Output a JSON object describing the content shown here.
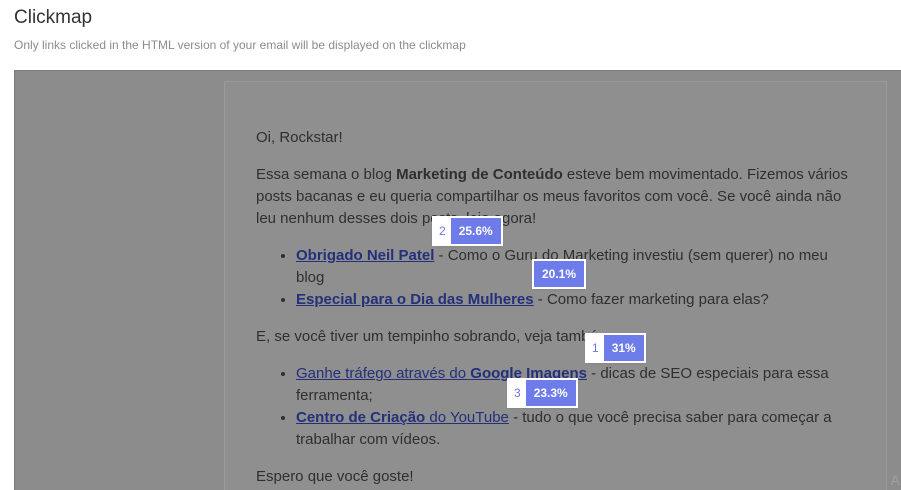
{
  "header": {
    "title": "Clickmap",
    "subtitle": "Only links clicked in the HTML version of your email will be displayed on the clickmap"
  },
  "email": {
    "greeting": "Oi, Rockstar!",
    "para1_start": "Essa semana o blog ",
    "para1_bold": "Marketing de Conteúdo",
    "para1_end": " esteve bem movimentado. Fizemos vários posts bacanas e eu queria compartilhar os meus favoritos com você. Se você ainda não leu nenhum desses dois posts, leia agora!",
    "list1": [
      {
        "link": "Obrigado Neil Patel",
        "text": " - Como o Guru do Marketing investiu (sem querer) no meu blog"
      },
      {
        "link": "Especial para o Dia das Mulheres",
        "text": " - Como fazer marketing para elas?"
      }
    ],
    "para2": "E, se você tiver um tempinho sobrando, veja também:",
    "list2": [
      {
        "link_plain": "Ganhe tráfego através do ",
        "link_bold": "Google Imagens",
        "text": " - dicas de SEO especiais para essa ferramenta;"
      },
      {
        "link_bold": "Centro de Criação",
        "link_plain": " do YouTube",
        "text": " - tudo o que você precisa saber para começar a trabalhar com vídeos."
      }
    ],
    "closing": "Espero que você goste!"
  },
  "clicks": [
    {
      "rank": "2",
      "percent": "25.6%"
    },
    {
      "rank": "",
      "percent": "20.1%"
    },
    {
      "rank": "1",
      "percent": "31%"
    },
    {
      "rank": "3",
      "percent": "23.3%"
    }
  ],
  "corner_glyph": "A",
  "colors": {
    "overlay": "#8c8c8c",
    "badge_fill": "#6d7ce8",
    "badge_rank_text": "#6b77e0",
    "link": "#23307a"
  }
}
